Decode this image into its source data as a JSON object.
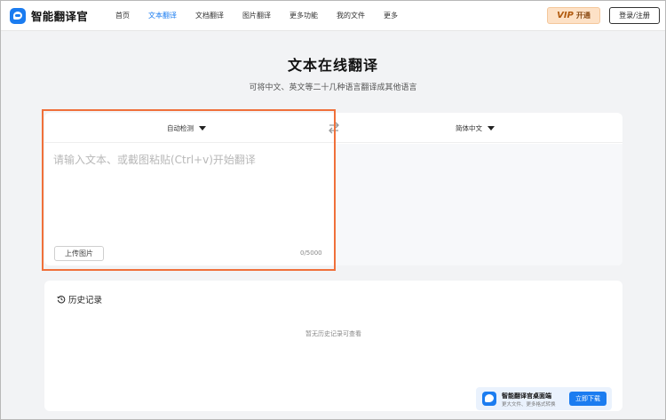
{
  "header": {
    "logo_text": "智能翻译官",
    "nav": [
      {
        "label": "首页",
        "active": false
      },
      {
        "label": "文本翻译",
        "active": true
      },
      {
        "label": "文档翻译",
        "active": false
      },
      {
        "label": "图片翻译",
        "active": false
      },
      {
        "label": "更多功能",
        "active": false
      },
      {
        "label": "我的文件",
        "active": false
      },
      {
        "label": "更多",
        "active": false
      }
    ],
    "vip_tag": "VIP",
    "vip_label": "开通",
    "login_label": "登录/注册"
  },
  "hero": {
    "title": "文本在线翻译",
    "subtitle": "可将中文、英文等二十几种语言翻译成其他语言"
  },
  "translator": {
    "source_lang": "自动检测",
    "target_lang": "简体中文",
    "input_placeholder": "请输入文本、或截图粘贴(Ctrl+v)开始翻译",
    "upload_label": "上传图片",
    "char_count": "0/5000"
  },
  "history": {
    "title": "历史记录",
    "empty_text": "暂无历史记录可查看"
  },
  "banner": {
    "title": "智能翻译官桌面端",
    "subtitle": "更大文件、更多格式转换",
    "download_label": "立即下载"
  },
  "colors": {
    "accent": "#1b7cf0",
    "highlight": "#f0703a",
    "vip_bg": "#fde1c6"
  }
}
